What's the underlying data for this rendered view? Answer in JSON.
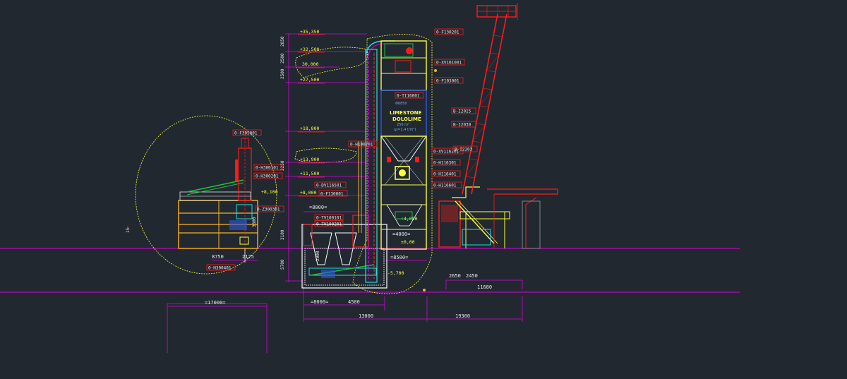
{
  "colors": {
    "background": "#212830",
    "magenta": "#e000e0",
    "yellow": "#ffff3a",
    "red": "#ff1a1a",
    "cyan": "#20e0e0",
    "white": "#e8e8e8",
    "green": "#20c040",
    "orange": "#ffb020",
    "blue": "#2f5ae0",
    "grey": "#9a9a9a"
  },
  "elevations": [
    {
      "id": "e35350",
      "text": "+35,350"
    },
    {
      "id": "e32500",
      "text": "+32,500"
    },
    {
      "id": "e30000",
      "text": "30,000"
    },
    {
      "id": "e27500",
      "text": "+27,500"
    },
    {
      "id": "e18800",
      "text": "+18,800"
    },
    {
      "id": "e13900",
      "text": "+13,900"
    },
    {
      "id": "e11500",
      "text": "+11,500"
    },
    {
      "id": "e8000",
      "text": "+8,000"
    },
    {
      "id": "e8100",
      "text": "+8,100"
    },
    {
      "id": "e4000",
      "text": "+4,000"
    },
    {
      "id": "e000",
      "text": "±0,00"
    },
    {
      "id": "em5700",
      "text": "-5,700"
    }
  ],
  "vertical_dims": [
    {
      "id": "v2850",
      "text": "2850"
    },
    {
      "id": "v2500a",
      "text": "2500"
    },
    {
      "id": "v2500b",
      "text": "2500"
    },
    {
      "id": "v2250",
      "text": "2250"
    },
    {
      "id": "v3100",
      "text": "3100"
    },
    {
      "id": "v5700",
      "text": "5700"
    },
    {
      "id": "v3800",
      "text": "3800"
    },
    {
      "id": "v2000",
      "text": "2000"
    },
    {
      "id": "v15",
      "text": "15"
    }
  ],
  "horizontal_dims": [
    {
      "id": "h17000",
      "text": "=17000="
    },
    {
      "id": "h8000a",
      "text": "=8000="
    },
    {
      "id": "h8000b",
      "text": "=8000="
    },
    {
      "id": "h4500",
      "text": "4500"
    },
    {
      "id": "h13000",
      "text": "13000"
    },
    {
      "id": "h19300",
      "text": "19300"
    },
    {
      "id": "h8500",
      "text": "=8500="
    },
    {
      "id": "h4000",
      "text": "=4000="
    },
    {
      "id": "h2650",
      "text": "2650"
    },
    {
      "id": "h2450",
      "text": "2450"
    },
    {
      "id": "h11680",
      "text": "11680"
    },
    {
      "id": "h8750",
      "text": "8750"
    },
    {
      "id": "h2125",
      "text": "2125"
    }
  ],
  "tags": [
    {
      "id": "t_f130201",
      "text": "0-F130201"
    },
    {
      "id": "t_xv101001",
      "text": "0-XV101001"
    },
    {
      "id": "t_f103001",
      "text": "0-F103001"
    },
    {
      "id": "t_ti16001",
      "text": "0-TI16001"
    },
    {
      "id": "t_b12015",
      "text": "B-I2015"
    },
    {
      "id": "t_b12030",
      "text": "B-I2030"
    },
    {
      "id": "t_b12203",
      "text": "B-I2203"
    },
    {
      "id": "t_xv116201",
      "text": "0-XV116201"
    },
    {
      "id": "t_h116301",
      "text": "0-H116301"
    },
    {
      "id": "t_h116401",
      "text": "0-H116401"
    },
    {
      "id": "t_h116601",
      "text": "0-H116601"
    },
    {
      "id": "t_h100701",
      "text": "0-H100701"
    },
    {
      "id": "t_f305001",
      "text": "0-F305001"
    },
    {
      "id": "t_h300101",
      "text": "0-H300101"
    },
    {
      "id": "t_h300201",
      "text": "0-H300201"
    },
    {
      "id": "t_z300301",
      "text": "0-Z300301"
    },
    {
      "id": "t_h300401",
      "text": "0-H300401"
    },
    {
      "id": "t_dv116501",
      "text": "0-DV116501"
    },
    {
      "id": "t_f130001",
      "text": "0-F130001"
    },
    {
      "id": "t_tv100101",
      "text": "0-TV100101"
    },
    {
      "id": "t_tv100201",
      "text": "0-TV100201"
    }
  ],
  "silo": {
    "diameter": "Φ6850",
    "line1": "LIMESTONE",
    "line2": "DOLOLIME",
    "sub1": "250 m³",
    "sub2": "(ρ=1.4 t/m³)"
  }
}
